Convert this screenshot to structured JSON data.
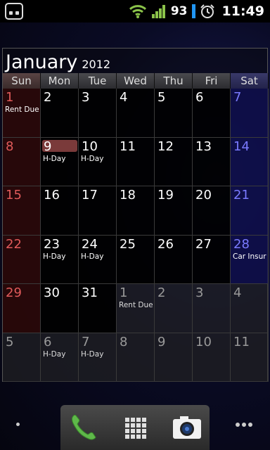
{
  "status": {
    "battery": "93",
    "time": "11:49",
    "icons": [
      "app-icon",
      "wifi-icon",
      "signal-icon",
      "battery-icon",
      "alarm-icon"
    ]
  },
  "calendar": {
    "month": "January",
    "year": "2012",
    "weekdays": [
      "Sun",
      "Mon",
      "Tue",
      "Wed",
      "Thu",
      "Fri",
      "Sat"
    ],
    "days": [
      {
        "n": "1",
        "ev": "Rent Due",
        "type": "sun"
      },
      {
        "n": "2",
        "ev": "",
        "type": ""
      },
      {
        "n": "3",
        "ev": "",
        "type": ""
      },
      {
        "n": "4",
        "ev": "",
        "type": ""
      },
      {
        "n": "5",
        "ev": "",
        "type": ""
      },
      {
        "n": "6",
        "ev": "",
        "type": ""
      },
      {
        "n": "7",
        "ev": "",
        "type": "sat"
      },
      {
        "n": "8",
        "ev": "",
        "type": "sun"
      },
      {
        "n": "9",
        "ev": "H-Day",
        "type": "today"
      },
      {
        "n": "10",
        "ev": "H-Day",
        "type": ""
      },
      {
        "n": "11",
        "ev": "",
        "type": ""
      },
      {
        "n": "12",
        "ev": "",
        "type": ""
      },
      {
        "n": "13",
        "ev": "",
        "type": ""
      },
      {
        "n": "14",
        "ev": "",
        "type": "sat"
      },
      {
        "n": "15",
        "ev": "",
        "type": "sun"
      },
      {
        "n": "16",
        "ev": "",
        "type": ""
      },
      {
        "n": "17",
        "ev": "",
        "type": ""
      },
      {
        "n": "18",
        "ev": "",
        "type": ""
      },
      {
        "n": "19",
        "ev": "",
        "type": ""
      },
      {
        "n": "20",
        "ev": "",
        "type": ""
      },
      {
        "n": "21",
        "ev": "",
        "type": "sat"
      },
      {
        "n": "22",
        "ev": "",
        "type": "sun"
      },
      {
        "n": "23",
        "ev": "H-Day",
        "type": ""
      },
      {
        "n": "24",
        "ev": "H-Day",
        "type": ""
      },
      {
        "n": "25",
        "ev": "",
        "type": ""
      },
      {
        "n": "26",
        "ev": "",
        "type": ""
      },
      {
        "n": "27",
        "ev": "",
        "type": ""
      },
      {
        "n": "28",
        "ev": "Car Insur",
        "type": "sat"
      },
      {
        "n": "29",
        "ev": "",
        "type": "sun"
      },
      {
        "n": "30",
        "ev": "",
        "type": ""
      },
      {
        "n": "31",
        "ev": "",
        "type": ""
      },
      {
        "n": "1",
        "ev": "Rent Due",
        "type": "other"
      },
      {
        "n": "2",
        "ev": "",
        "type": "other"
      },
      {
        "n": "3",
        "ev": "",
        "type": "other"
      },
      {
        "n": "4",
        "ev": "",
        "type": "other"
      },
      {
        "n": "5",
        "ev": "",
        "type": "other"
      },
      {
        "n": "6",
        "ev": "H-Day",
        "type": "other"
      },
      {
        "n": "7",
        "ev": "H-Day",
        "type": "other"
      },
      {
        "n": "8",
        "ev": "",
        "type": "other"
      },
      {
        "n": "9",
        "ev": "",
        "type": "other"
      },
      {
        "n": "10",
        "ev": "",
        "type": "other"
      },
      {
        "n": "11",
        "ev": "",
        "type": "other"
      }
    ]
  },
  "dock": {
    "items": [
      "phone-icon",
      "app-drawer-icon",
      "camera-icon"
    ]
  },
  "colors": {
    "sunday": "#e05a5a",
    "saturday": "#7a7aff",
    "today_highlight": "#7a3a3a",
    "battery": "#2196f3",
    "wifi": "#8bc34a"
  }
}
